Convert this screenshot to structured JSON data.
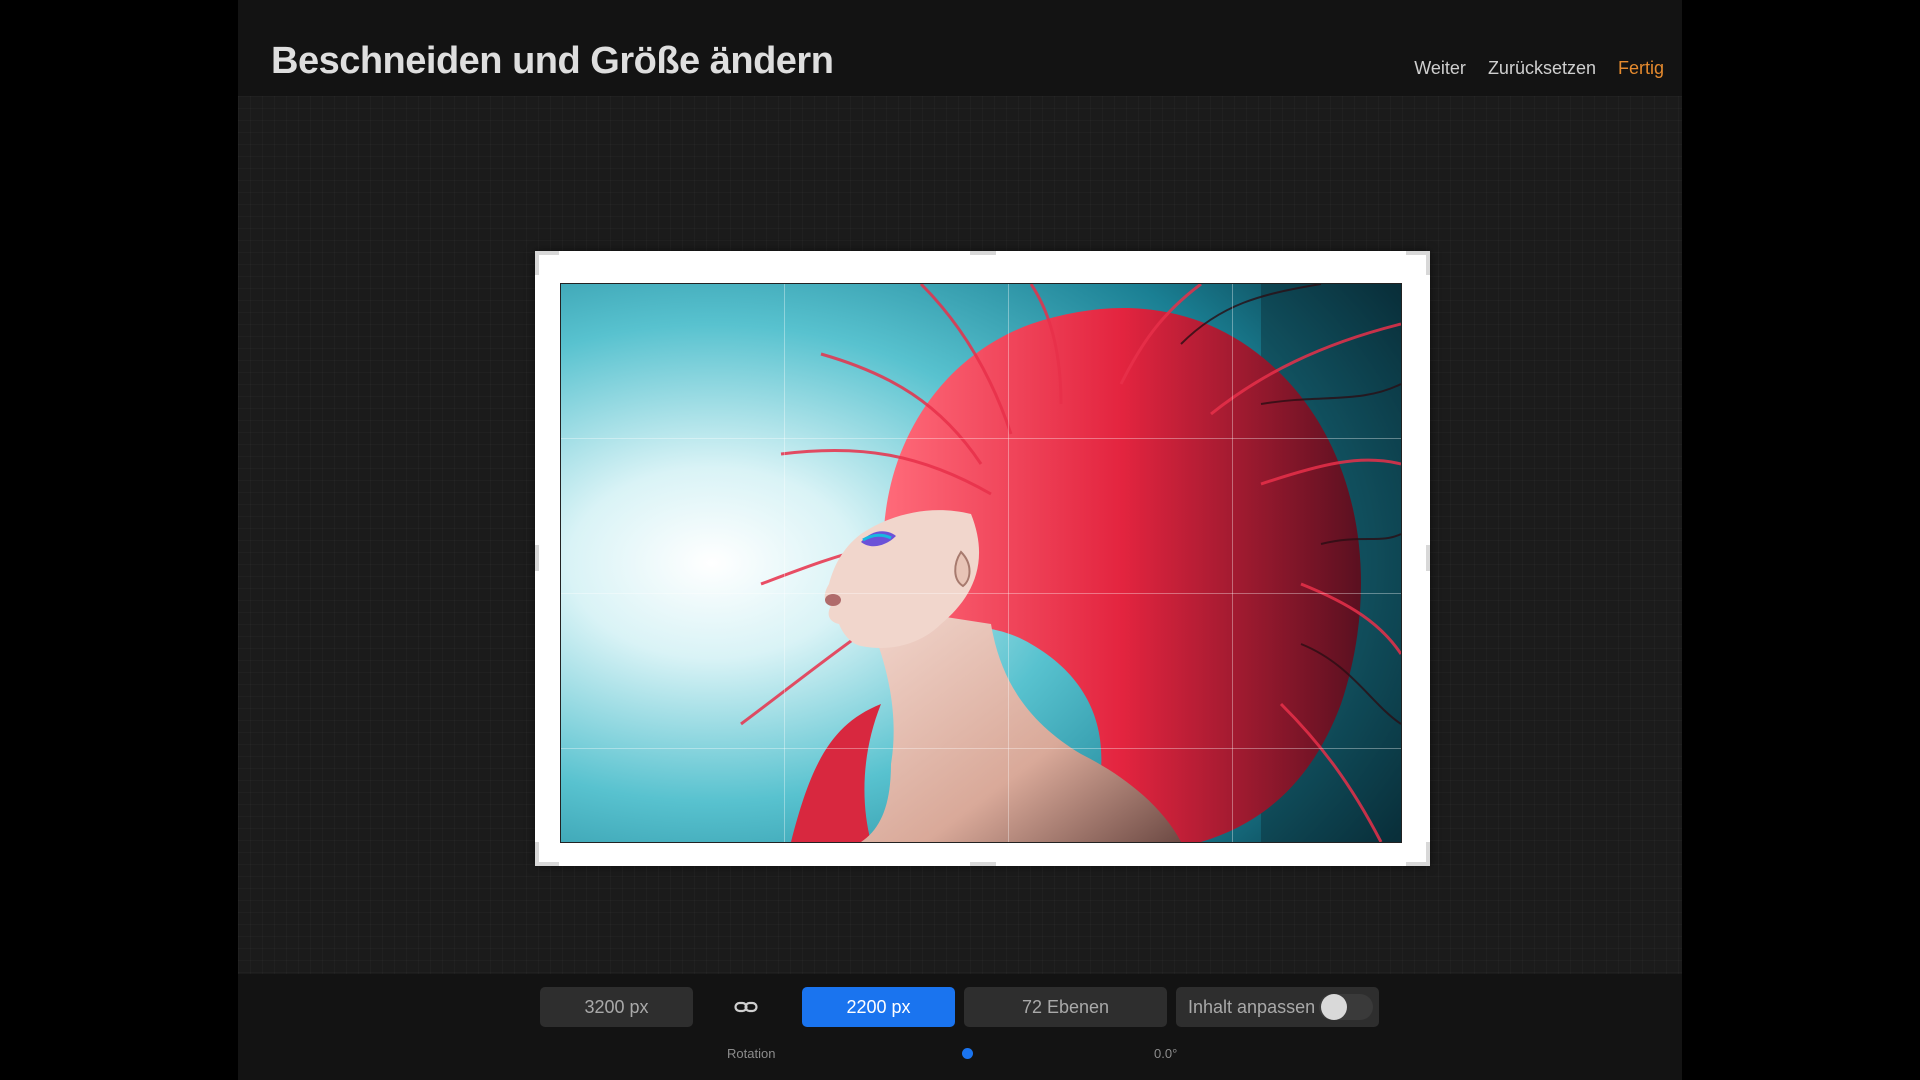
{
  "header": {
    "title": "Beschneiden und Größe ändern",
    "actions": {
      "next": "Weiter",
      "reset": "Zurücksetzen",
      "done": "Fertig"
    }
  },
  "toolbar": {
    "width_value": "3200 px",
    "height_value": "2200 px",
    "layers_value": "72 Ebenen",
    "fit_label": "Inhalt anpassen",
    "fit_enabled": false,
    "rotation_label": "Rotation",
    "rotation_value": "0.0°"
  },
  "icons": {
    "link": "link-chain-icon"
  },
  "colors": {
    "accent": "#1a74ef",
    "done": "#e58a2e",
    "background": "#141414"
  }
}
